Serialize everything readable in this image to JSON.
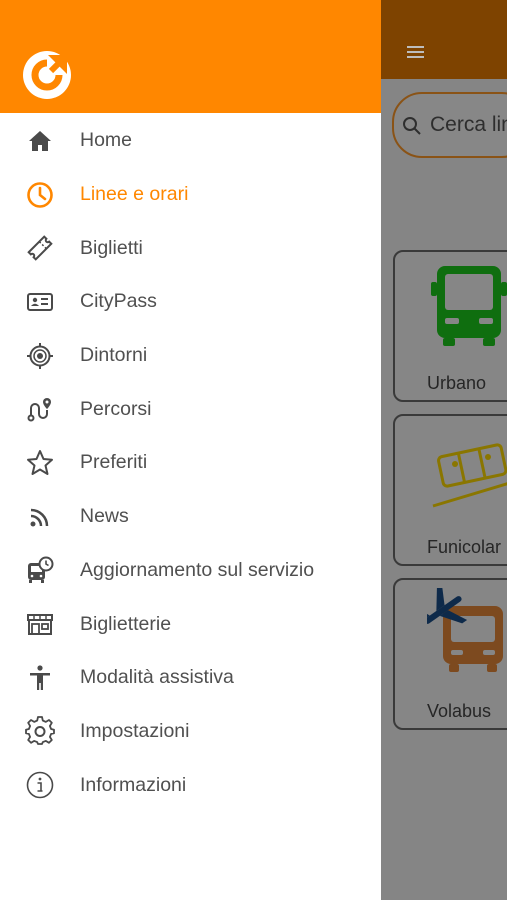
{
  "colors": {
    "brand_orange": "#ff8700",
    "active_text": "#ff8700",
    "menu_text": "#505050",
    "icon_gray": "#4a4a4a"
  },
  "drawer": {
    "logo_icon": "brand-logo-arrow-icon",
    "items": [
      {
        "label": "Home",
        "icon": "home-icon",
        "active": false
      },
      {
        "label": "Linee e orari",
        "icon": "clock-icon",
        "active": true
      },
      {
        "label": "Biglietti",
        "icon": "ticket-icon",
        "active": false
      },
      {
        "label": "CityPass",
        "icon": "id-card-icon",
        "active": false
      },
      {
        "label": "Dintorni",
        "icon": "target-icon",
        "active": false
      },
      {
        "label": "Percorsi",
        "icon": "route-icon",
        "active": false
      },
      {
        "label": "Preferiti",
        "icon": "star-icon",
        "active": false
      },
      {
        "label": "News",
        "icon": "rss-icon",
        "active": false
      },
      {
        "label": "Aggiornamento sul servizio",
        "icon": "bus-clock-icon",
        "active": false
      },
      {
        "label": "Biglietterie",
        "icon": "store-icon",
        "active": false
      },
      {
        "label": "Modalità assistiva",
        "icon": "accessibility-icon",
        "active": false
      },
      {
        "label": "Impostazioni",
        "icon": "gear-icon",
        "active": false
      },
      {
        "label": "Informazioni",
        "icon": "info-icon",
        "active": false
      }
    ]
  },
  "background": {
    "menu_icon": "hamburger-icon",
    "search_placeholder": "Cerca lin",
    "cards": [
      {
        "label": "Urbano",
        "icon": "bus-icon"
      },
      {
        "label": "Funicolar",
        "icon": "funicular-icon"
      },
      {
        "label": "Volabus",
        "icon": "airport-bus-icon"
      }
    ]
  }
}
